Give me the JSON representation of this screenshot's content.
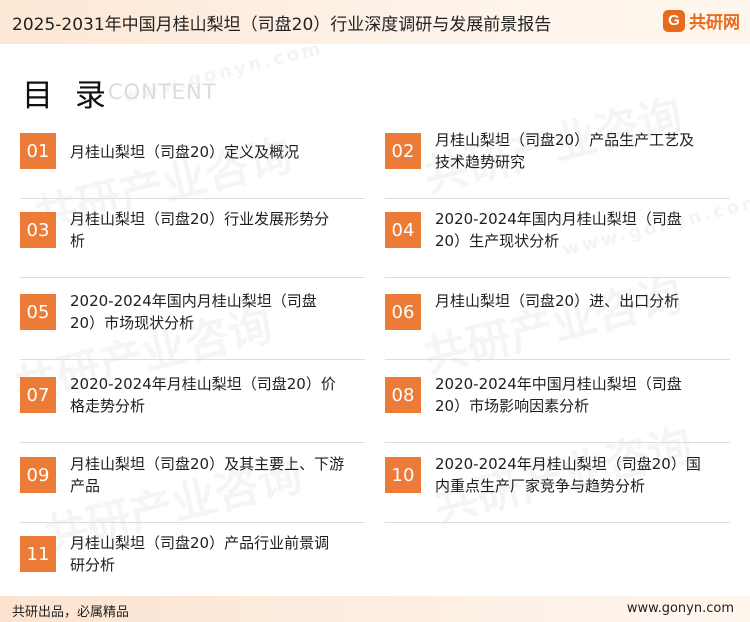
{
  "header": {
    "title": "2025-2031年中国月桂山梨坦（司盘20）行业深度调研与发展前景报告",
    "logo_mark": "G",
    "logo_text": "共研网"
  },
  "watermark": {
    "text": "共研产业咨询",
    "url": "www.gonyn.com"
  },
  "toc": {
    "heading": "目 录",
    "subheading": "CONTENT",
    "items": [
      {
        "num": "01",
        "text": "月桂山梨坦（司盘20）定义及概况"
      },
      {
        "num": "02",
        "text": "月桂山梨坦（司盘20）产品生产工艺及技术趋势研究"
      },
      {
        "num": "03",
        "text": "月桂山梨坦（司盘20）行业发展形势分析"
      },
      {
        "num": "04",
        "text": "2020-2024年国内月桂山梨坦（司盘20）生产现状分析"
      },
      {
        "num": "05",
        "text": "2020-2024年国内月桂山梨坦（司盘20）市场现状分析"
      },
      {
        "num": "06",
        "text": "月桂山梨坦（司盘20）进、出口分析"
      },
      {
        "num": "07",
        "text": "2020-2024年月桂山梨坦（司盘20）价格走势分析"
      },
      {
        "num": "08",
        "text": "2020-2024年中国月桂山梨坦（司盘20）市场影响因素分析"
      },
      {
        "num": "09",
        "text": "月桂山梨坦（司盘20）及其主要上、下游产品"
      },
      {
        "num": "10",
        "text": "2020-2024年月桂山梨坦（司盘20）国内重点生产厂家竞争与趋势分析"
      },
      {
        "num": "11",
        "text": "月桂山梨坦（司盘20）产品行业前景调研分析"
      }
    ]
  },
  "footer": {
    "slogan": "共研出品，必属精品",
    "website": "www.gonyn.com"
  }
}
